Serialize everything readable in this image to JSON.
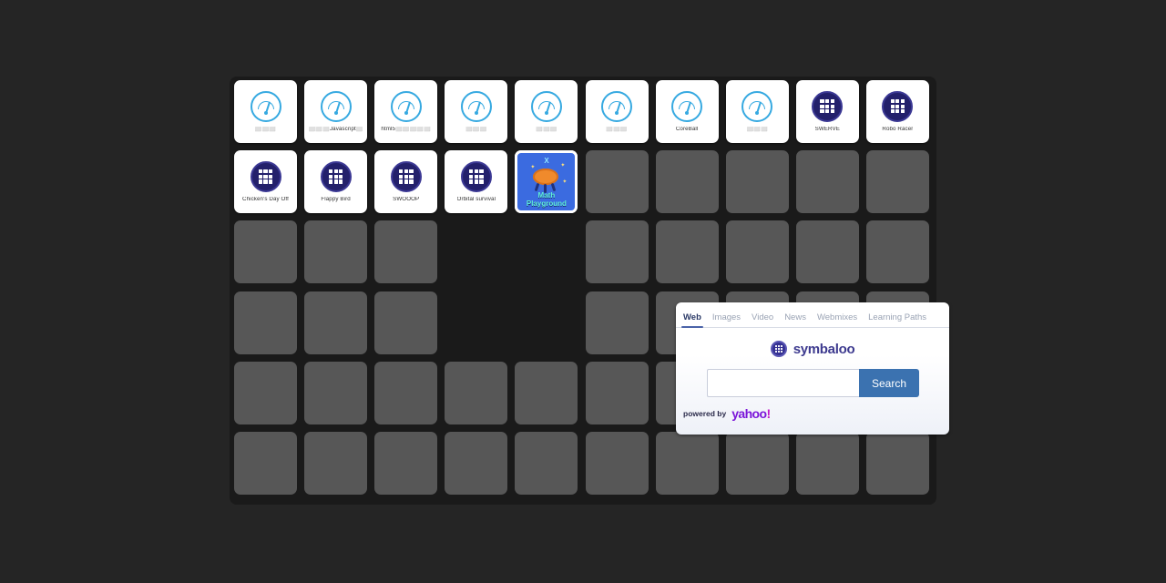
{
  "board": {
    "columns": 10,
    "rows": 6,
    "empty_tile_color": "#575757",
    "board_color": "#1a1a1a",
    "page_color": "#252525"
  },
  "tiles": [
    {
      "row": 0,
      "col": 0,
      "type": "gauge",
      "label": "⬜⬜⬜",
      "icon": "gauge-icon"
    },
    {
      "row": 0,
      "col": 1,
      "type": "gauge",
      "label": "⬜⬜⬜Javascript⬜",
      "icon": "gauge-icon"
    },
    {
      "row": 0,
      "col": 2,
      "type": "gauge",
      "label": "html5⬜⬜⬜⬜⬜",
      "icon": "gauge-icon"
    },
    {
      "row": 0,
      "col": 3,
      "type": "gauge",
      "label": "⬜⬜⬜",
      "icon": "gauge-icon"
    },
    {
      "row": 0,
      "col": 4,
      "type": "gauge",
      "label": "⬜⬜⬜",
      "icon": "gauge-icon"
    },
    {
      "row": 0,
      "col": 5,
      "type": "gauge",
      "label": "⬜⬜⬜",
      "icon": "gauge-icon"
    },
    {
      "row": 0,
      "col": 6,
      "type": "gauge",
      "label": "CoreBall",
      "icon": "gauge-icon"
    },
    {
      "row": 0,
      "col": 7,
      "type": "gauge",
      "label": "⬜⬜⬜",
      "icon": "gauge-icon"
    },
    {
      "row": 0,
      "col": 8,
      "type": "symbaloo",
      "label": "SWERVE",
      "icon": "symbaloo-grid-icon"
    },
    {
      "row": 0,
      "col": 9,
      "type": "symbaloo",
      "label": "Robo Racer",
      "icon": "symbaloo-grid-icon"
    },
    {
      "row": 1,
      "col": 0,
      "type": "symbaloo",
      "label": "Chicken's Day Off",
      "icon": "symbaloo-grid-icon"
    },
    {
      "row": 1,
      "col": 1,
      "type": "symbaloo",
      "label": "Flappy Bird",
      "icon": "symbaloo-grid-icon"
    },
    {
      "row": 1,
      "col": 2,
      "type": "symbaloo",
      "label": "SWOOOP",
      "icon": "symbaloo-grid-icon"
    },
    {
      "row": 1,
      "col": 3,
      "type": "symbaloo",
      "label": "Orbital survival",
      "icon": "symbaloo-grid-icon"
    },
    {
      "row": 1,
      "col": 4,
      "type": "mathplayground",
      "label": "",
      "icon": "math-playground-icon",
      "art": {
        "line1": "Math",
        "line2": "Playground",
        "variable": "X",
        "bg_color": "#3b6be0",
        "text_color": "#5ff0d8"
      }
    }
  ],
  "search_widget": {
    "tabs": [
      {
        "label": "Web",
        "active": true
      },
      {
        "label": "Images",
        "active": false
      },
      {
        "label": "Video",
        "active": false
      },
      {
        "label": "News",
        "active": false
      },
      {
        "label": "Webmixes",
        "active": false
      },
      {
        "label": "Learning Paths",
        "active": false
      }
    ],
    "brand": "symbaloo",
    "input_value": "",
    "input_placeholder": "",
    "search_label": "Search",
    "powered_label": "powered by",
    "provider": "yahoo",
    "provider_mark": "!",
    "accent_color": "#3b72b0",
    "brand_color": "#3d3a8f",
    "provider_color": "#7b16d9"
  }
}
